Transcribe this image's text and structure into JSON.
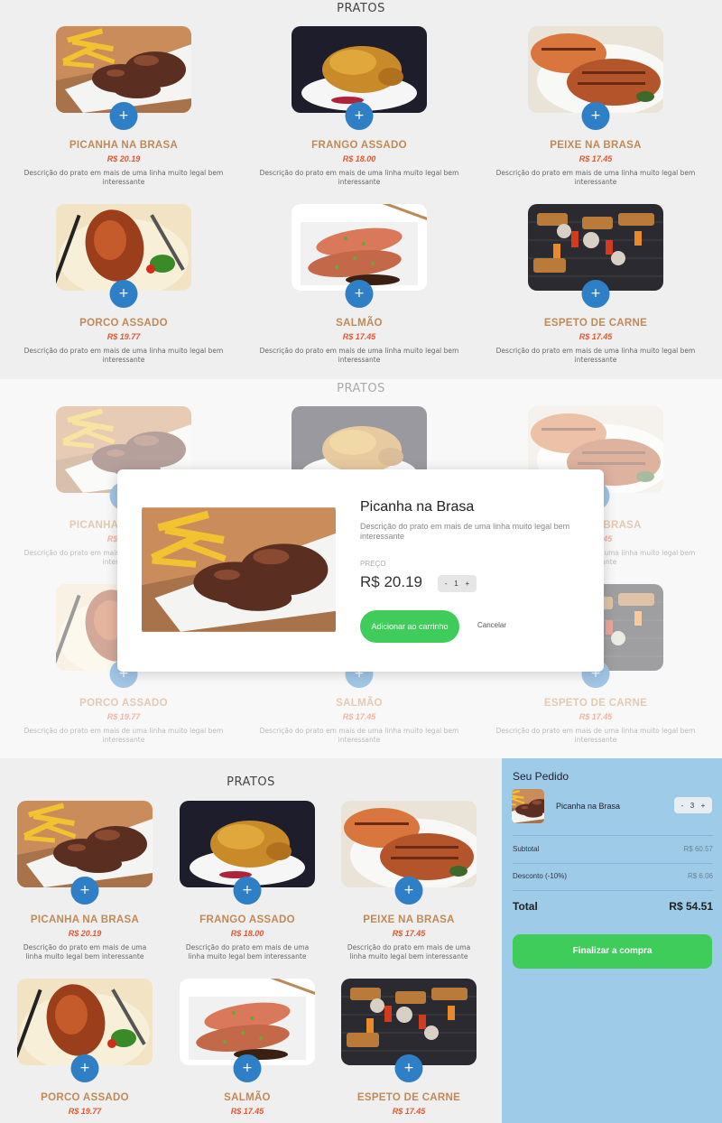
{
  "section_title": "PRATOS",
  "add_icon": "plus-icon",
  "description": "Descrição do prato em mais de uma linha muito legal bem interessante",
  "dishes": [
    {
      "name": "PICANHA NA BRASA",
      "price": "R$ 20.19"
    },
    {
      "name": "FRANGO ASSADO",
      "price": "R$ 18.00"
    },
    {
      "name": "PEIXE NA BRASA",
      "price": "R$ 17.45"
    },
    {
      "name": "PORCO ASSADO",
      "price": "R$ 19.77"
    },
    {
      "name": "SALMÃO",
      "price": "R$ 17.45"
    },
    {
      "name": "ESPETO DE CARNE",
      "price": "R$ 17.45"
    }
  ],
  "modal": {
    "title": "Picanha na Brasa",
    "description": "Descrição do prato em mais de uma linha muito legal bem interessante",
    "price_label": "PREÇO",
    "price": "R$ 20.19",
    "qty_minus": "-",
    "qty": "1",
    "qty_plus": "+",
    "add_label": "Adicionar ao carrinho",
    "cancel_label": "Cancelar"
  },
  "cart": {
    "title": "Seu Pedido",
    "item_name": "Picanha na Brasa",
    "qty_minus": "-",
    "qty": "3",
    "qty_plus": "+",
    "subtotal_label": "Subtotal",
    "subtotal": "R$ 60.57",
    "discount_label": "Desconto (-10%)",
    "discount": "R$ 6.06",
    "total_label": "Total",
    "total": "R$ 54.51",
    "checkout_label": "Finalizar a compra"
  },
  "colors": {
    "accent": "#2f7fc6",
    "green": "#3fcc5a",
    "dish_name": "#c08a58",
    "price": "#e4572e",
    "sidebar": "#9dcbe8"
  }
}
